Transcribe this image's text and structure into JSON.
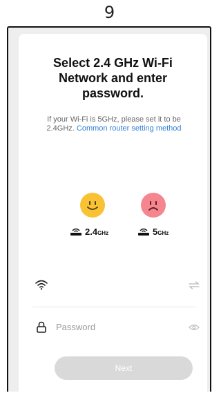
{
  "step": {
    "number": "9"
  },
  "screen": {
    "title": "Select 2.4 GHz Wi-Fi Network and enter password.",
    "hint": {
      "text": "If your Wi-Fi is 5GHz, please set it to be 2.4GHz.",
      "link": "Common router setting method"
    },
    "bands": [
      {
        "main": "2.4",
        "unit": "GHz",
        "face": "happy",
        "face_color": "#f9c134"
      },
      {
        "main": "5",
        "unit": "GHz",
        "face": "sad",
        "face_color": "#f5858e"
      }
    ],
    "wifi_field": {
      "value": "",
      "icon": "wifi-icon",
      "action_icon": "switch-network-icon"
    },
    "password_field": {
      "placeholder": "Password",
      "value": "",
      "icon": "lock-icon",
      "action_icon": "eye-icon"
    },
    "next_button": {
      "label": "Next",
      "enabled": false
    }
  },
  "colors": {
    "link": "#2f7fd6",
    "button_disabled": "#d9d9d9",
    "frame_background": "#eeeeee"
  }
}
